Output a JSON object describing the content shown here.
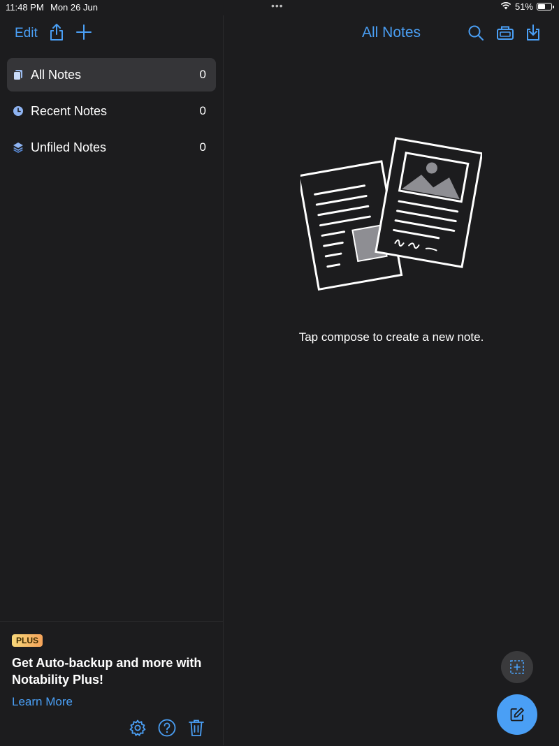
{
  "status_bar": {
    "time": "11:48 PM",
    "date": "Mon 26 Jun",
    "battery": "51%",
    "battery_level": 0.51
  },
  "toolbar": {
    "edit_label": "Edit",
    "title": "All Notes"
  },
  "sidebar": {
    "items": [
      {
        "label": "All Notes",
        "count": "0",
        "icon": "notes-stack-icon"
      },
      {
        "label": "Recent Notes",
        "count": "0",
        "icon": "clock-icon"
      },
      {
        "label": "Unfiled Notes",
        "count": "0",
        "icon": "layers-icon"
      }
    ],
    "selected_index": 0
  },
  "promo": {
    "badge": "PLUS",
    "title": "Get Auto-backup and more with Notability Plus!",
    "link": "Learn More"
  },
  "main": {
    "empty_message": "Tap compose to create a new note."
  },
  "colors": {
    "accent": "#4a9ff5",
    "background": "#1c1c1e",
    "selected_row": "#353538"
  }
}
